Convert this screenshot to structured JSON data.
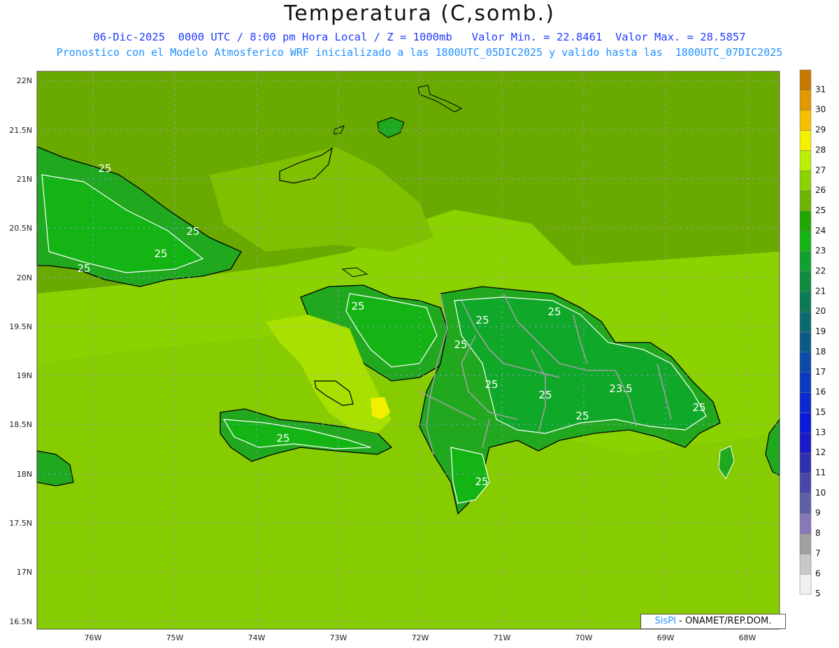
{
  "header": {
    "title": "Temperatura (C,somb.)",
    "subtitle1": "06-Dic-2025  0000 UTC / 8:00 pm Hora Local / Z = 1000mb   Valor Min. = 22.8461  Valor Max. = 28.5857",
    "subtitle2": "Pronostico con el Modelo Atmosferico WRF inicializado a las 1800UTC_05DIC2025 y valido hasta las  1800UTC_07DIC2025"
  },
  "axes": {
    "lat_labels": [
      "22N",
      "21.5N",
      "21N",
      "20.5N",
      "20N",
      "19.5N",
      "19N",
      "18.5N",
      "18N",
      "17.5N",
      "17N",
      "16.5N"
    ],
    "lon_labels": [
      "76W",
      "75W",
      "74W",
      "73W",
      "72W",
      "71W",
      "70W",
      "69W",
      "68W"
    ]
  },
  "contour_labels": [
    "25",
    "25",
    "25",
    "25",
    "25",
    "25",
    "25",
    "25",
    "25",
    "25",
    "25",
    "23.5",
    "25",
    "25",
    "25"
  ],
  "colorbar": {
    "labels": [
      "31",
      "30",
      "29",
      "28",
      "27",
      "26",
      "25",
      "24",
      "23",
      "22",
      "21",
      "20",
      "19",
      "18",
      "17",
      "16",
      "15",
      "13",
      "12",
      "11",
      "10",
      "9",
      "8",
      "7",
      "6",
      "5"
    ],
    "colors": [
      "#c87a00",
      "#e09a00",
      "#f5c000",
      "#f5f000",
      "#b8f000",
      "#8cd200",
      "#6fb400",
      "#20a800",
      "#14b414",
      "#10a030",
      "#0e8c40",
      "#0c7a55",
      "#0a6a70",
      "#0a5a8a",
      "#0a4aa8",
      "#0a3ac0",
      "#0a2ad0",
      "#0a1ad8",
      "#1a1ac8",
      "#3030b0",
      "#4848a8",
      "#6060a8",
      "#8878b8",
      "#a0a0a0",
      "#c8c8c8",
      "#f0f0f0"
    ]
  },
  "legend_colors": {
    "sea": "#66a800",
    "land_low": "#8cd200",
    "land_mid": "#22a81e",
    "hot_spot": "#f0f000",
    "border": "#a0a0a0"
  },
  "credit": {
    "brand": "SisPI",
    "text": " - ONAMET/REP.DOM."
  }
}
